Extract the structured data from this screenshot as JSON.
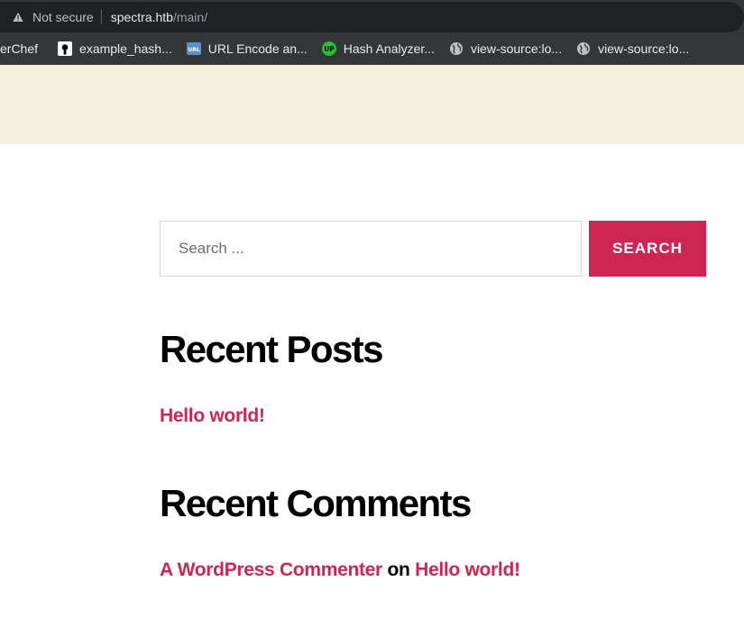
{
  "browser": {
    "security_label": "Not secure",
    "url_host": "spectra.htb",
    "url_path": "/main/",
    "bookmarks": [
      {
        "label": "erChef",
        "icon": ""
      },
      {
        "label": "example_hash...",
        "icon": "github-icon"
      },
      {
        "label": "URL Encode an...",
        "icon": "url-icon"
      },
      {
        "label": "Hash Analyzer...",
        "icon": "up-icon"
      },
      {
        "label": "view-source:lo...",
        "icon": "globe-icon"
      },
      {
        "label": "view-source:lo...",
        "icon": "globe-icon"
      }
    ]
  },
  "search": {
    "placeholder": "Search ...",
    "button_label": "SEARCH"
  },
  "recent_posts": {
    "title": "Recent Posts",
    "items": [
      "Hello world!"
    ]
  },
  "recent_comments": {
    "title": "Recent Comments",
    "author": "A WordPress Commenter",
    "connector": "on",
    "post": "Hello world!"
  },
  "colors": {
    "accent": "#cd2653",
    "header_band": "#f5efe0",
    "browser_chrome": "#35363a"
  }
}
